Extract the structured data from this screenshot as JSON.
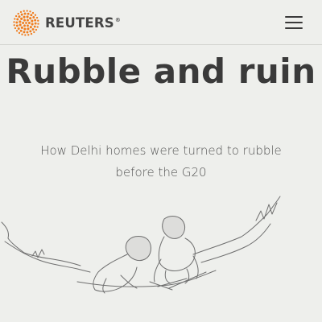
{
  "header": {
    "logo_text": "REUTERS",
    "logo_registered": "®",
    "logo_icon": "reuters-dot-logo-icon",
    "menu_icon": "hamburger-menu-icon"
  },
  "article": {
    "title": "Rubble and ruin",
    "subtitle": "How Delhi homes were turned to rubble before the G20",
    "illustration_icon": "pencil-sketch-children-in-rubble-illustration"
  },
  "colors": {
    "background": "#eeefec",
    "logo_orange": "#f07d1e",
    "text_dark": "#3a3a3a"
  }
}
